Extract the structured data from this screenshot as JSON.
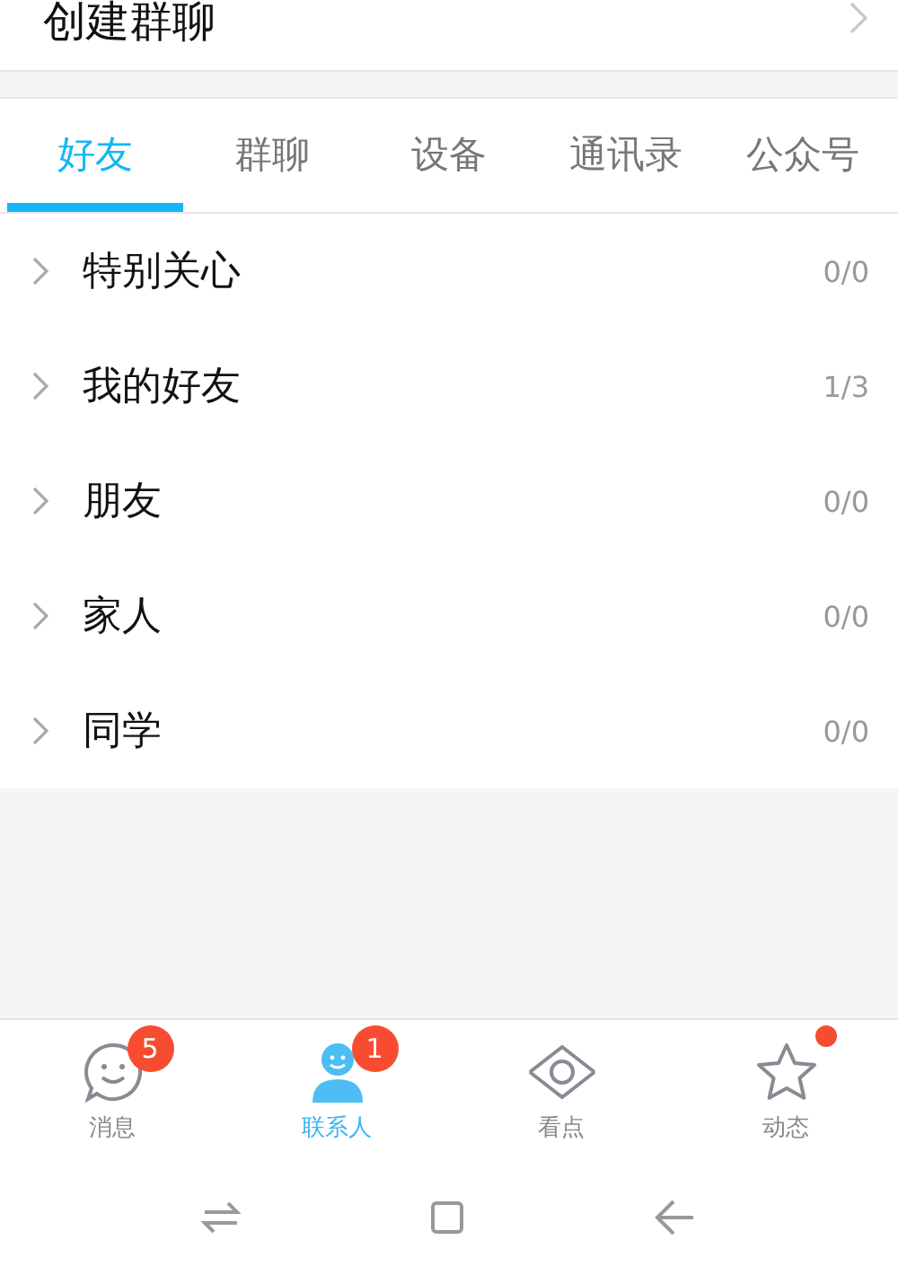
{
  "create_group": {
    "label": "创建群聊"
  },
  "tabs": [
    {
      "label": "好友",
      "selected": true
    },
    {
      "label": "群聊",
      "selected": false
    },
    {
      "label": "设备",
      "selected": false
    },
    {
      "label": "通讯录",
      "selected": false
    },
    {
      "label": "公众号",
      "selected": false
    }
  ],
  "groups": [
    {
      "name": "特别关心",
      "count": "0/0",
      "expanded": false
    },
    {
      "name": "我的好友",
      "count": "1/3",
      "expanded": false
    },
    {
      "name": "朋友",
      "count": "0/0",
      "expanded": false
    },
    {
      "name": "家人",
      "count": "0/0",
      "expanded": false
    },
    {
      "name": "同学",
      "count": "0/0",
      "expanded": false
    }
  ],
  "bottom_nav": [
    {
      "kind": "messages",
      "label": "消息",
      "selected": false,
      "badge": "5"
    },
    {
      "kind": "contacts",
      "label": "联系人",
      "selected": true,
      "badge": "1"
    },
    {
      "kind": "watch",
      "label": "看点",
      "selected": false
    },
    {
      "kind": "moments",
      "label": "动态",
      "selected": false,
      "dot": true
    }
  ]
}
